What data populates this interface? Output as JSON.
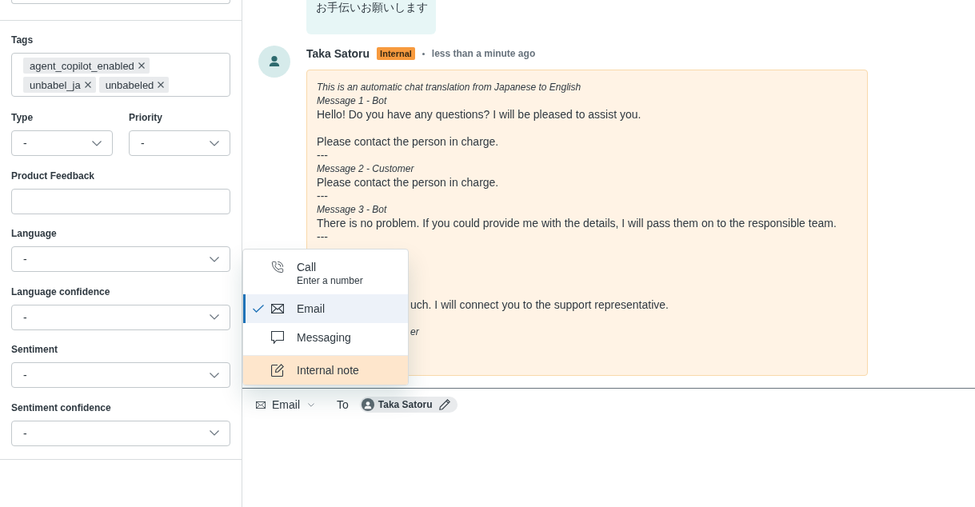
{
  "sidebar": {
    "fields": [
      {
        "kind": "tags",
        "label": "Tags",
        "tags": [
          "agent_copilot_enabled",
          "unbabel_ja",
          "unbabeled"
        ]
      },
      {
        "kind": "pair",
        "fields": [
          {
            "label": "Type",
            "value": "-"
          },
          {
            "label": "Priority",
            "value": "-"
          }
        ]
      },
      {
        "kind": "input",
        "label": "Product Feedback"
      },
      {
        "kind": "select",
        "label": "Language",
        "value": "-"
      },
      {
        "kind": "select",
        "label": "Language confidence",
        "value": "-"
      },
      {
        "kind": "select",
        "label": "Sentiment",
        "value": "-"
      },
      {
        "kind": "select",
        "label": "Sentiment confidence",
        "value": "-"
      }
    ]
  },
  "conversation": {
    "previous_message": {
      "text": "お手伝いお願いします"
    },
    "note": {
      "author": "Taka Satoru",
      "badge": "Internal",
      "time": "less than a minute ago",
      "lines": [
        {
          "kind": "meta",
          "text": "This is an automatic chat translation from Japanese to English"
        },
        {
          "kind": "meta",
          "text": "Message 1 - Bot"
        },
        {
          "kind": "text",
          "text": "Hello! Do you have any questions? I will be pleased to assist you."
        },
        {
          "kind": "gap"
        },
        {
          "kind": "text",
          "text": "Please contact the person in charge."
        },
        {
          "kind": "rule",
          "text": "---"
        },
        {
          "kind": "meta",
          "text": "Message 2 - Customer"
        },
        {
          "kind": "text",
          "text": "Please contact the person in charge."
        },
        {
          "kind": "rule",
          "text": "---"
        },
        {
          "kind": "meta",
          "text": "Message 3 - Bot"
        },
        {
          "kind": "text",
          "text": "There is no problem. If you could provide me with the details, I will pass them on to the responsible team."
        },
        {
          "kind": "rule",
          "text": "---"
        },
        {
          "kind": "gap"
        },
        {
          "kind": "gap"
        },
        {
          "kind": "gap"
        },
        {
          "kind": "gap"
        },
        {
          "kind": "cuttext",
          "text": "uch. I will connect you to the support representative."
        },
        {
          "kind": "gap"
        },
        {
          "kind": "cutmeta",
          "text": "er"
        },
        {
          "kind": "gap"
        },
        {
          "kind": "gap"
        }
      ]
    }
  },
  "channel_menu": {
    "items": [
      {
        "kind": "call",
        "label": "Call",
        "hint": "Enter a number",
        "selected": false,
        "highlighted": false
      },
      {
        "kind": "email",
        "label": "Email",
        "selected": true,
        "highlighted": false
      },
      {
        "kind": "messaging",
        "label": "Messaging",
        "selected": false,
        "highlighted": false
      },
      {
        "kind": "note",
        "label": "Internal note",
        "selected": false,
        "highlighted": true
      }
    ]
  },
  "composer": {
    "channel": "Email",
    "to_label": "To",
    "recipient": "Taka Satoru"
  }
}
